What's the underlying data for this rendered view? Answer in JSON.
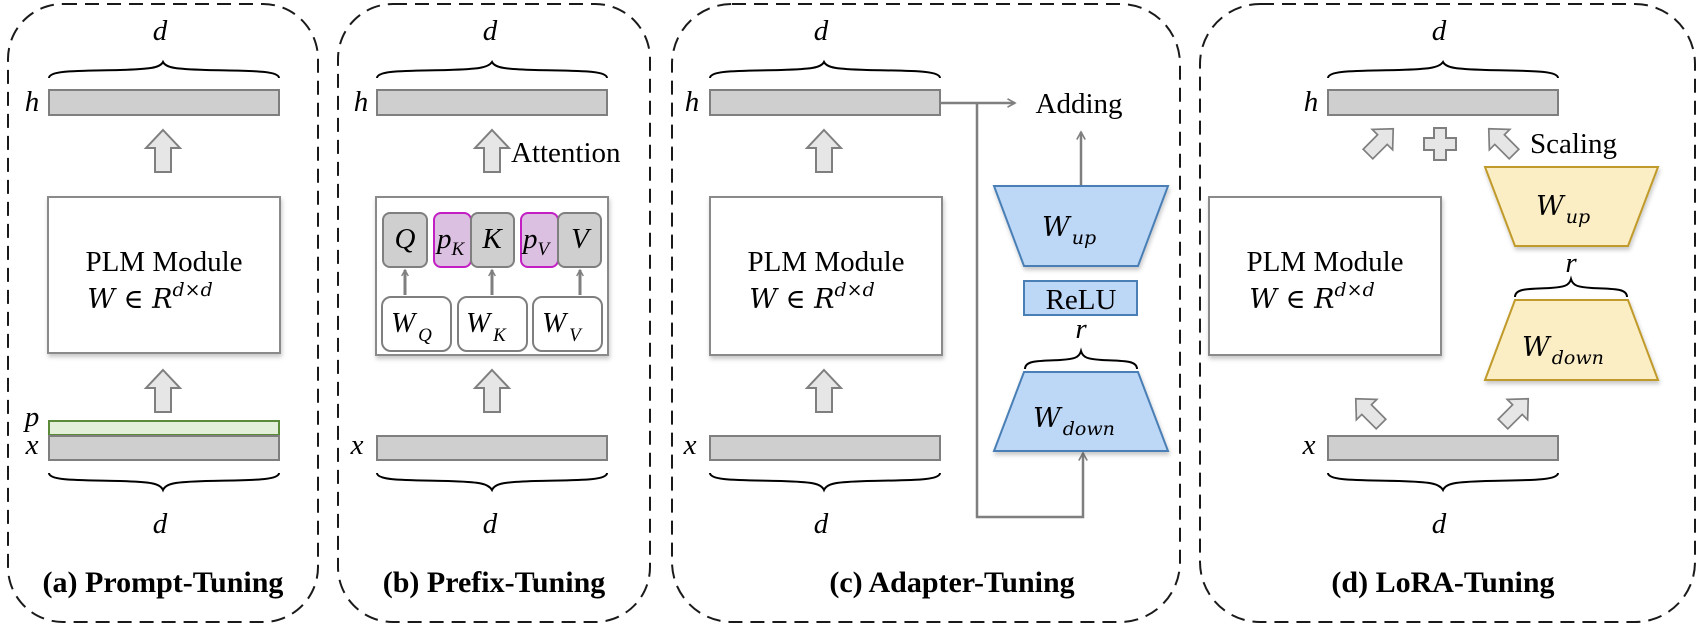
{
  "figure": {
    "panels": [
      {
        "id": "a",
        "caption": "(a) Prompt-Tuning",
        "top_dim_label": "d",
        "bottom_dim_label": "d",
        "output_label": "h",
        "input_label": "x",
        "prompt_label": "p",
        "module_title": "PLM Module",
        "module_formula_base": "W ∈ R",
        "module_formula_sup": "d×d"
      },
      {
        "id": "b",
        "caption": "(b) Prefix-Tuning",
        "top_dim_label": "d",
        "bottom_dim_label": "d",
        "output_label": "h",
        "input_label": "x",
        "arrow_label": "Attention",
        "attention_cells": [
          {
            "base": "Q",
            "sub": "",
            "type": "qkv"
          },
          {
            "base": "p",
            "sub": "K",
            "type": "prefix"
          },
          {
            "base": "K",
            "sub": "",
            "type": "qkv"
          },
          {
            "base": "p",
            "sub": "V",
            "type": "prefix"
          },
          {
            "base": "V",
            "sub": "",
            "type": "qkv"
          }
        ],
        "weight_cells": [
          {
            "base": "W",
            "sub": "Q"
          },
          {
            "base": "W",
            "sub": "K"
          },
          {
            "base": "W",
            "sub": "V"
          }
        ]
      },
      {
        "id": "c",
        "caption": "(c) Adapter-Tuning",
        "top_dim_label": "d",
        "bottom_dim_label": "d",
        "output_label": "h",
        "input_label": "x",
        "module_title": "PLM Module",
        "module_formula_base": "W ∈ R",
        "module_formula_sup": "d×d",
        "adding_label": "Adding",
        "up_base": "W",
        "up_sub": "up",
        "down_base": "W",
        "down_sub": "down",
        "activation_label": "ReLU",
        "rank_label": "r"
      },
      {
        "id": "d",
        "caption": "(d) LoRA-Tuning",
        "top_dim_label": "d",
        "bottom_dim_label": "d",
        "output_label": "h",
        "input_label": "x",
        "module_title": "PLM Module",
        "module_formula_base": "W ∈ R",
        "module_formula_sup": "d×d",
        "scaling_label": "Scaling",
        "up_base": "W",
        "up_sub": "up",
        "down_base": "W",
        "down_sub": "down",
        "rank_label": "r"
      }
    ],
    "colors": {
      "bar_fill": "#d0cfcf",
      "bar_stroke": "#7f7f7f",
      "prompt_fill": "#e3efd9",
      "prompt_stroke": "#5a8a3a",
      "prefix_fill": "#dcc0e2",
      "prefix_stroke": "#c31ec3",
      "adapter_fill": "#bdd7f7",
      "adapter_stroke": "#4a7fb5",
      "lora_fill": "#fbeec4",
      "lora_stroke": "#c09a2a",
      "arrow_fill": "#e6e6e6",
      "line": "#7f7f7f"
    }
  }
}
